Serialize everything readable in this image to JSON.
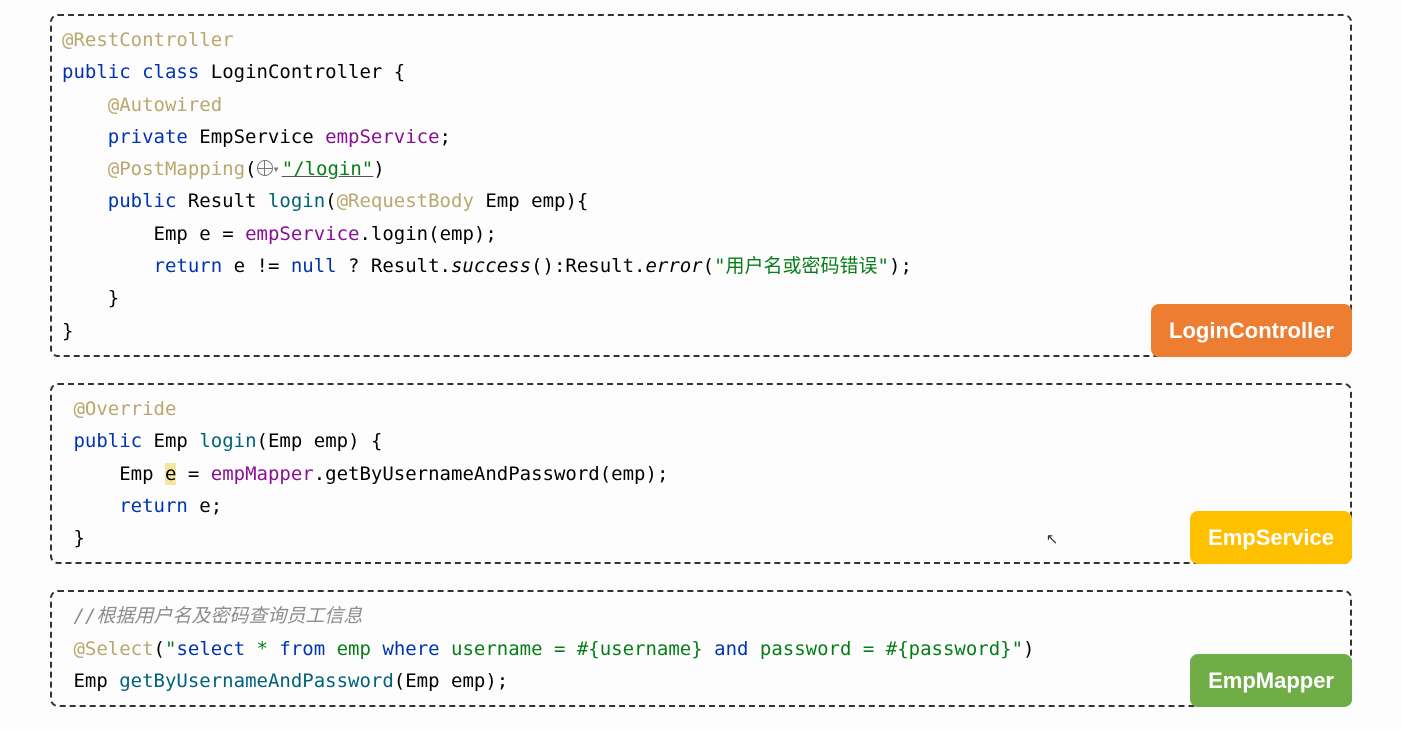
{
  "block1": {
    "badge": "LoginController",
    "ann_restcontroller": "@RestController",
    "kw_public": "public",
    "kw_class": "class",
    "cls_name": "LoginController",
    "ann_autowired": "@Autowired",
    "kw_private": "private",
    "type_empservice": "EmpService",
    "field_empservice": "empService",
    "ann_postmapping": "@PostMapping",
    "route": "\"/login\"",
    "type_result": "Result",
    "method_login": "login",
    "ann_requestbody": "@RequestBody",
    "type_emp": "Emp",
    "param_emp": "emp",
    "var_e": "e",
    "call_login": "login",
    "kw_return": "return",
    "kw_null": "null",
    "call_success": "success",
    "call_error": "error",
    "err_msg": "\"用户名或密码错误\""
  },
  "block2": {
    "badge": "EmpService",
    "ann_override": "@Override",
    "kw_public": "public",
    "type_emp": "Emp",
    "method_login": "login",
    "param_emp": "emp",
    "var_e": "e",
    "field_empmapper": "empMapper",
    "call_getby": "getByUsernameAndPassword",
    "kw_return": "return"
  },
  "block3": {
    "badge": "EmpMapper",
    "comment": "//根据用户名及密码查询员工信息",
    "ann_select": "@Select",
    "sql_open": "\"",
    "sql_select": "select",
    "sql_star_from": " * ",
    "sql_from": "from",
    "sql_emp": " emp ",
    "sql_where": "where",
    "sql_username": " username ",
    "sql_eq": "=",
    "sql_p_user": " #{username} ",
    "sql_and": "and",
    "sql_password": " password ",
    "sql_p_pass": " #{password}",
    "sql_close": "\"",
    "type_emp": "Emp",
    "method_getby": "getByUsernameAndPassword",
    "param_emp": "emp"
  }
}
